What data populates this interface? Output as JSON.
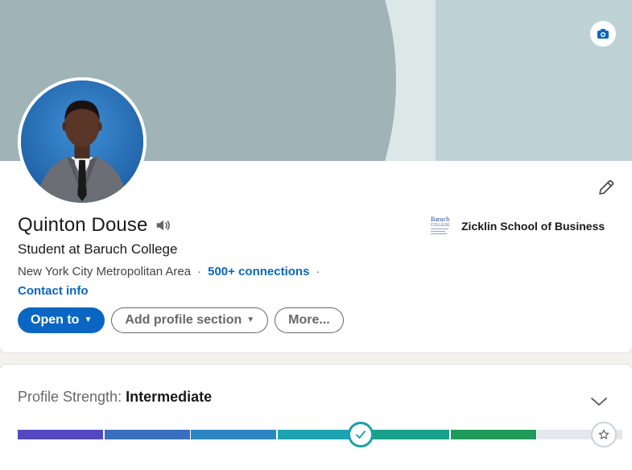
{
  "profile": {
    "name": "Quinton Douse",
    "headline": "Student at Baruch College",
    "location": "New York City Metropolitan Area",
    "connections": "500+ connections",
    "separator": "·",
    "contact_info": "Contact info"
  },
  "actions": {
    "open_to": "Open to",
    "add_profile_section": "Add profile section",
    "more": "More..."
  },
  "education": {
    "school_name": "Zicklin School of Business",
    "logo_text": [
      "Baruch",
      "COLLEGE"
    ]
  },
  "profile_strength": {
    "label": "Profile Strength: ",
    "level": "Intermediate",
    "segments_total": 7,
    "segments_completed": 4
  },
  "icons": {
    "banner_camera": "camera-icon",
    "edit": "pencil-icon",
    "pronunciation": "speaker-icon",
    "collapse": "chevron-down-icon",
    "current_level": "check-icon",
    "goal_level": "star-icon"
  },
  "colors": {
    "brand_blue": "#0a66c2",
    "banner_dark": "#a0b4b7",
    "banner_light": "#bfd3d6",
    "meter_gradient": [
      "#5a4fc0",
      "#2f7fbf",
      "#17a2a8",
      "#1f9a5a"
    ]
  }
}
